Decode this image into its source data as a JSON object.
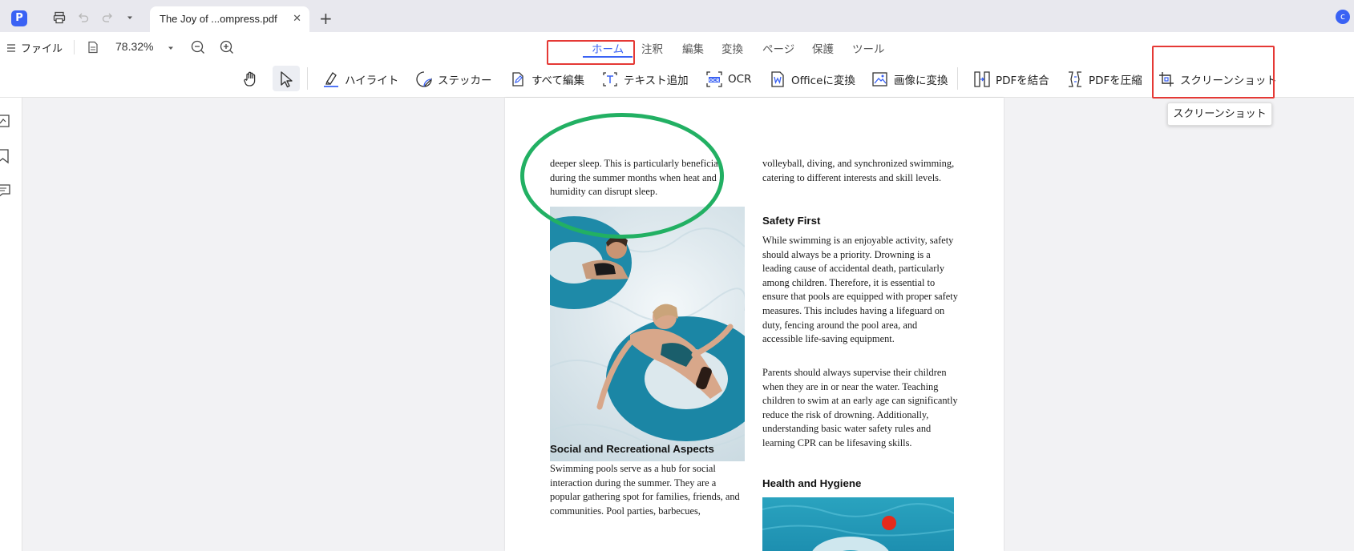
{
  "titlebar": {
    "tab_title": "The Joy of ...ompress.pdf",
    "tab_close": "✕",
    "new_tab": "+",
    "avatar_letter": "c",
    "app_logo": "P"
  },
  "toolbar": {
    "file_menu": "ファイル",
    "zoom": "78.32%",
    "menu_tabs": [
      "ホーム",
      "注釈",
      "編集",
      "変換",
      "ページ",
      "保護",
      "ツール"
    ],
    "tools": {
      "highlight": "ハイライト",
      "sticker": "ステッカー",
      "edit_all": "すべて編集",
      "add_text": "テキスト追加",
      "ocr": "OCR",
      "to_office": "Officeに変換",
      "to_image": "画像に変換",
      "merge_pdf": "PDFを結合",
      "compress_pdf": "PDFを圧縮",
      "screenshot": "スクリーンショット"
    }
  },
  "tooltip": "スクリーンショット",
  "document": {
    "left_col_para1": "deeper sleep. This is particularly beneficial during the summer months when heat and humidity can disrupt sleep.",
    "right_col_para0": "volleyball, diving, and synchronized swimming, catering to different interests and skill levels.",
    "heading_safety": "Safety First",
    "safety_para1": "While swimming is an enjoyable activity, safety should always be a priority. Drowning is a leading cause of accidental death, particularly among children. Therefore, it is essential to ensure that pools are equipped with proper safety measures. This includes having a lifeguard on duty, fencing around the pool area, and accessible life-saving equipment.",
    "safety_para2": "Parents should always supervise their children when they are in or near the water. Teaching children to swim at an early age can significantly reduce the risk of drowning. Additionally, understanding basic water safety rules and learning CPR can be lifesaving skills.",
    "heading_social": "Social and Recreational Aspects",
    "social_para": "Swimming pools serve as a hub for social interaction during the summer. They are a popular gathering spot for families, friends, and communities. Pool parties, barbecues,",
    "heading_health": "Health and Hygiene"
  },
  "colors": {
    "accent": "#3a62f4",
    "annotation_red": "#e53935",
    "annotation_green": "#22b063"
  }
}
